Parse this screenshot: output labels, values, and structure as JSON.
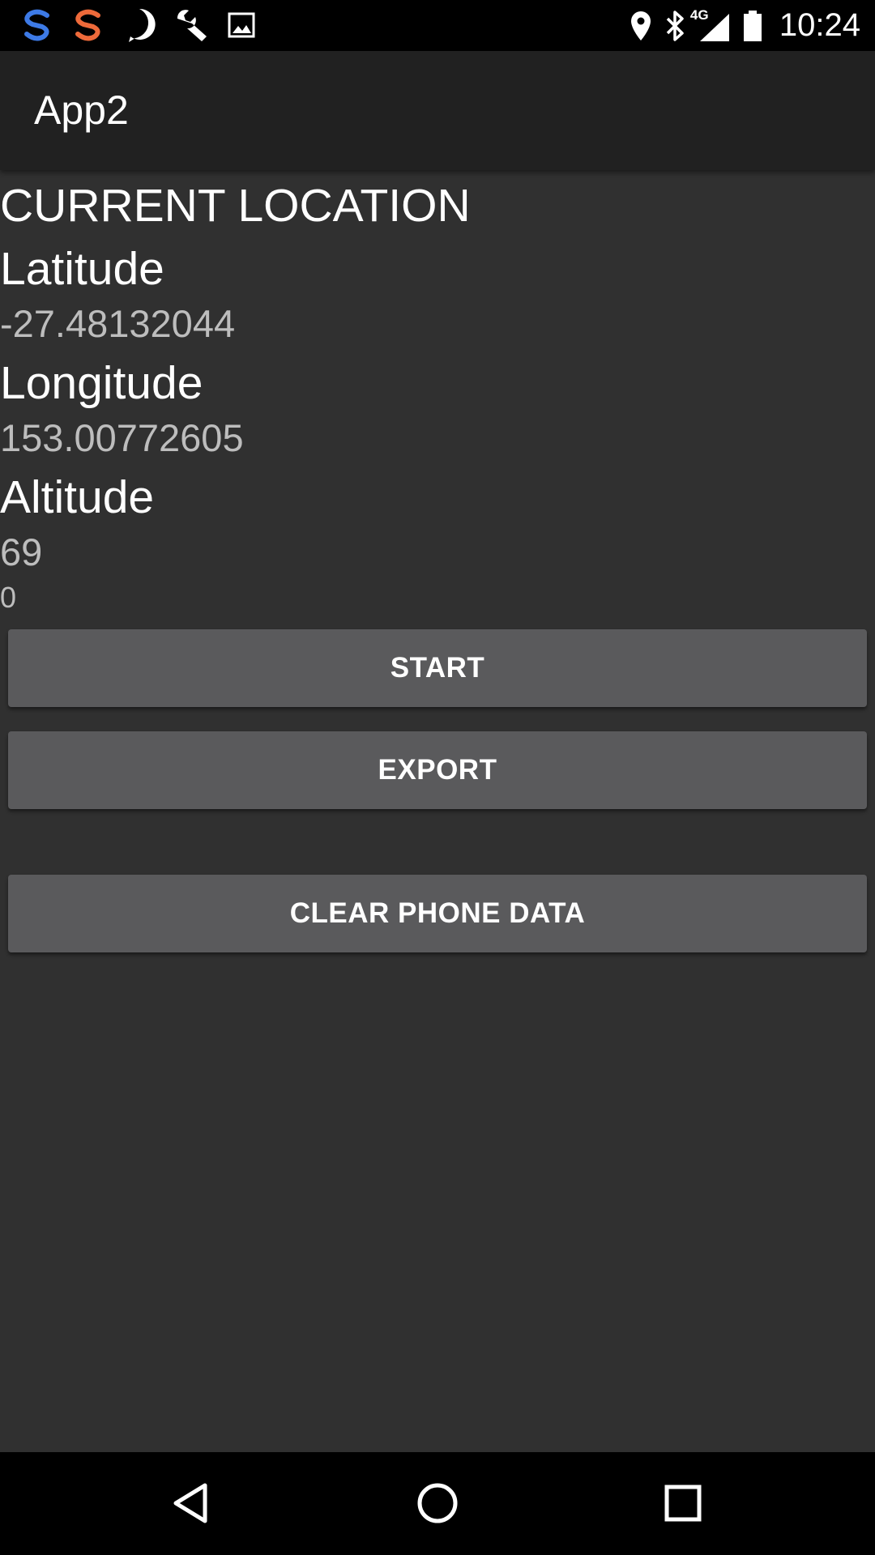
{
  "status_bar": {
    "left_icons": [
      "s-app-blue-icon",
      "s-app-orange-icon",
      "keyhole-notification-icon",
      "wrench-icon",
      "image-icon"
    ],
    "right_icons": [
      "location-pin-icon",
      "bluetooth-icon",
      "signal-4g-icon",
      "battery-icon"
    ],
    "network_label": "4G",
    "time": "10:24"
  },
  "app_bar": {
    "title": "App2"
  },
  "location": {
    "heading": "CURRENT LOCATION",
    "latitude_label": "Latitude",
    "latitude_value": "-27.48132044",
    "longitude_label": "Longitude",
    "longitude_value": "153.00772605",
    "altitude_label": "Altitude",
    "altitude_value": "69",
    "counter_value": "0"
  },
  "buttons": {
    "start": "START",
    "export": "EXPORT",
    "clear": "CLEAR PHONE DATA"
  },
  "nav_bar": {
    "icons": [
      "back-icon",
      "home-icon",
      "recents-icon"
    ]
  },
  "colors": {
    "background": "#303030",
    "app_bar": "#212121",
    "status_bar": "#000000",
    "button": "#5a5a5c",
    "heading_text": "#ffffff",
    "value_text": "#bdbdbd",
    "s_blue": "#3d7ae6",
    "s_orange": "#ee6a3a"
  }
}
